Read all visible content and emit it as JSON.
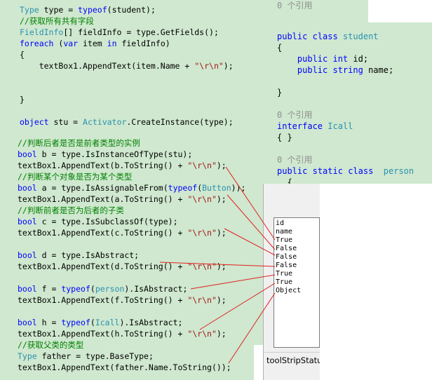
{
  "left_code_top": [
    [
      {
        "t": "Type",
        "c": "ty"
      },
      {
        "t": " type = ",
        "c": ""
      },
      {
        "t": "typeof",
        "c": "kw"
      },
      {
        "t": "(student);",
        "c": ""
      }
    ],
    [
      {
        "t": "//获取所有共有字段",
        "c": "cm"
      }
    ],
    [
      {
        "t": "FieldInfo",
        "c": "ty"
      },
      {
        "t": "[] fieldInfo = type.GetFields();",
        "c": ""
      }
    ],
    [
      {
        "t": "foreach",
        "c": "kw"
      },
      {
        "t": " (",
        "c": ""
      },
      {
        "t": "var",
        "c": "kw"
      },
      {
        "t": " item ",
        "c": ""
      },
      {
        "t": "in",
        "c": "kw"
      },
      {
        "t": " fieldInfo)",
        "c": ""
      }
    ],
    [
      {
        "t": "{",
        "c": ""
      }
    ],
    [
      {
        "t": "    textBox1.AppendText(item.Name + ",
        "c": ""
      },
      {
        "t": "\"\\r\\n\"",
        "c": "str"
      },
      {
        "t": ");",
        "c": ""
      }
    ],
    [
      {
        "t": "}",
        "c": ""
      }
    ],
    [
      {
        "t": "object",
        "c": "kw"
      },
      {
        "t": " stu = ",
        "c": ""
      },
      {
        "t": "Activator",
        "c": "ty"
      },
      {
        "t": ".CreateInstance(type);",
        "c": ""
      }
    ]
  ],
  "left_code_bottom": [
    [
      {
        "t": "//判断后者是否是前者类型的实例",
        "c": "cm"
      }
    ],
    [
      {
        "t": "bool",
        "c": "kw"
      },
      {
        "t": " b = type.IsInstanceOfType(stu);",
        "c": ""
      }
    ],
    [
      {
        "t": "textBox1.AppendText(b.ToString() + ",
        "c": ""
      },
      {
        "t": "\"\\r\\n\"",
        "c": "str"
      },
      {
        "t": ");",
        "c": ""
      }
    ],
    [
      {
        "t": "//判断某个对象是否为某个类型",
        "c": "cm"
      }
    ],
    [
      {
        "t": "bool",
        "c": "kw"
      },
      {
        "t": " a = type.IsAssignableFrom(",
        "c": ""
      },
      {
        "t": "typeof",
        "c": "kw"
      },
      {
        "t": "(",
        "c": ""
      },
      {
        "t": "Button",
        "c": "ty"
      },
      {
        "t": "));",
        "c": ""
      }
    ],
    [
      {
        "t": "textBox1.AppendText(a.ToString() + ",
        "c": ""
      },
      {
        "t": "\"\\r\\n\"",
        "c": "str"
      },
      {
        "t": ");",
        "c": ""
      }
    ],
    [
      {
        "t": "//判断前者是否为后者的子类",
        "c": "cm"
      }
    ],
    [
      {
        "t": "bool",
        "c": "kw"
      },
      {
        "t": " c = type.IsSubclassOf(type);",
        "c": ""
      }
    ],
    [
      {
        "t": "textBox1.AppendText(c.ToString() + ",
        "c": ""
      },
      {
        "t": "\"\\r\\n\"",
        "c": "str"
      },
      {
        "t": ");",
        "c": ""
      }
    ],
    [
      {
        "t": "",
        "c": ""
      }
    ],
    [
      {
        "t": "bool",
        "c": "kw"
      },
      {
        "t": " d = type.IsAbstract;",
        "c": ""
      }
    ],
    [
      {
        "t": "textBox1.AppendText(d.ToString() + ",
        "c": ""
      },
      {
        "t": "\"\\r\\n\"",
        "c": "str"
      },
      {
        "t": ");",
        "c": ""
      }
    ],
    [
      {
        "t": "",
        "c": ""
      }
    ],
    [
      {
        "t": "bool",
        "c": "kw"
      },
      {
        "t": " f = ",
        "c": ""
      },
      {
        "t": "typeof",
        "c": "kw"
      },
      {
        "t": "(",
        "c": ""
      },
      {
        "t": "person",
        "c": "ty"
      },
      {
        "t": ").IsAbstract;",
        "c": ""
      }
    ],
    [
      {
        "t": "textBox1.AppendText(f.ToString() + ",
        "c": ""
      },
      {
        "t": "\"\\r\\n\"",
        "c": "str"
      },
      {
        "t": ");",
        "c": ""
      }
    ],
    [
      {
        "t": "",
        "c": ""
      }
    ],
    [
      {
        "t": "bool",
        "c": "kw"
      },
      {
        "t": " h = ",
        "c": ""
      },
      {
        "t": "typeof",
        "c": "kw"
      },
      {
        "t": "(",
        "c": ""
      },
      {
        "t": "Icall",
        "c": "ty"
      },
      {
        "t": ").IsAbstract;",
        "c": ""
      }
    ],
    [
      {
        "t": "textBox1.AppendText(h.ToString() + ",
        "c": ""
      },
      {
        "t": "\"\\r\\n\"",
        "c": "str"
      },
      {
        "t": ");",
        "c": ""
      }
    ],
    [
      {
        "t": "//获取父类的类型",
        "c": "cm"
      }
    ],
    [
      {
        "t": "Type",
        "c": "ty"
      },
      {
        "t": " father = type.BaseType;",
        "c": ""
      }
    ],
    [
      {
        "t": "textBox1.AppendText(father.Name.ToString());",
        "c": ""
      }
    ]
  ],
  "right_code": [
    [
      {
        "t": "0 个引用",
        "c": "gray"
      }
    ],
    [
      {
        "t": "public",
        "c": "kw"
      },
      {
        "t": " ",
        "c": ""
      },
      {
        "t": "class",
        "c": "kw"
      },
      {
        "t": " ",
        "c": ""
      },
      {
        "t": "student",
        "c": "ty"
      }
    ],
    [
      {
        "t": "{",
        "c": ""
      }
    ],
    [
      {
        "t": "    public",
        "c": "kw"
      },
      {
        "t": " ",
        "c": ""
      },
      {
        "t": "int",
        "c": "kw"
      },
      {
        "t": " id;",
        "c": ""
      }
    ],
    [
      {
        "t": "    public",
        "c": "kw"
      },
      {
        "t": " ",
        "c": ""
      },
      {
        "t": "string",
        "c": "kw"
      },
      {
        "t": " name;",
        "c": ""
      }
    ],
    [
      {
        "t": "",
        "c": ""
      }
    ],
    [
      {
        "t": "}",
        "c": ""
      }
    ],
    [
      {
        "t": "",
        "c": ""
      }
    ],
    [
      {
        "t": "0 个引用",
        "c": "gray"
      }
    ],
    [
      {
        "t": "interface",
        "c": "kw"
      },
      {
        "t": " ",
        "c": ""
      },
      {
        "t": "Icall",
        "c": "ty"
      }
    ],
    [
      {
        "t": "{ }",
        "c": ""
      }
    ],
    [
      {
        "t": "",
        "c": ""
      }
    ],
    [
      {
        "t": "0 个引用",
        "c": "gray"
      }
    ],
    [
      {
        "t": "public",
        "c": "kw"
      },
      {
        "t": " ",
        "c": ""
      },
      {
        "t": "static",
        "c": "kw"
      },
      {
        "t": " ",
        "c": ""
      },
      {
        "t": "class",
        "c": "kw"
      },
      {
        "t": "  ",
        "c": ""
      },
      {
        "t": "person",
        "c": "ty"
      }
    ],
    [
      {
        "t": "  {",
        "c": ""
      }
    ]
  ],
  "output_lines": [
    "id",
    "name",
    "True",
    "False",
    "False",
    "False",
    "True",
    "True",
    "Object"
  ],
  "status_strip_label": "toolStripStatu",
  "colors": {
    "editor_bg": "#cfe8cf",
    "keyword": "#0000ff",
    "type": "#2b91af",
    "string": "#a31515",
    "comment": "#008000",
    "arrow": "#e02020"
  }
}
